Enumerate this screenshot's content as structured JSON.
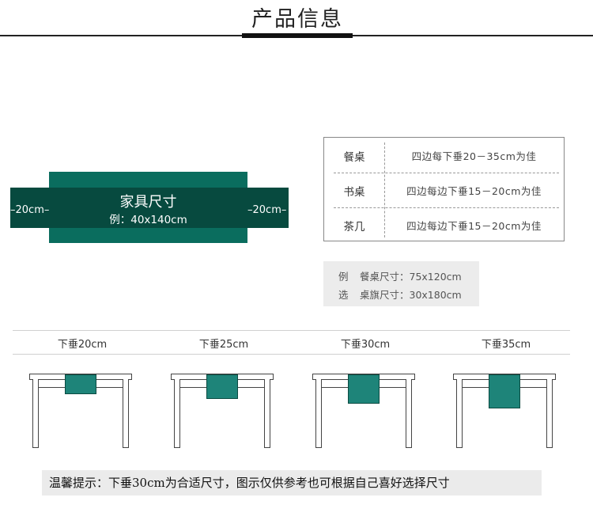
{
  "header": {
    "title": "产品信息"
  },
  "runner": {
    "title": "家具尺寸",
    "example": "例：40x140cm",
    "left_drop": "–20cm–",
    "right_drop": "–20cm–",
    "colors": {
      "main": "#0a6d5e",
      "band": "#074a3f"
    }
  },
  "size_table": [
    {
      "type": "餐桌",
      "desc": "四边每下垂20－35cm为佳"
    },
    {
      "type": "书桌",
      "desc": "四边每边下垂15－20cm为佳"
    },
    {
      "type": "茶几",
      "desc": "四边每边下垂15－20cm为佳"
    }
  ],
  "examples": [
    {
      "key": "例",
      "text": "餐桌尺寸：75x120cm"
    },
    {
      "key": "选",
      "text": "桌旗尺寸：30x180cm"
    }
  ],
  "drops": [
    {
      "label": "下垂20cm",
      "drop_cm": 20
    },
    {
      "label": "下垂25cm",
      "drop_cm": 25
    },
    {
      "label": "下垂30cm",
      "drop_cm": 30
    },
    {
      "label": "下垂35cm",
      "drop_cm": 35
    }
  ],
  "tip": {
    "text": "温馨提示：下垂30cm为合适尺寸，图示仅供参考也可根据自己喜好选择尺寸"
  }
}
